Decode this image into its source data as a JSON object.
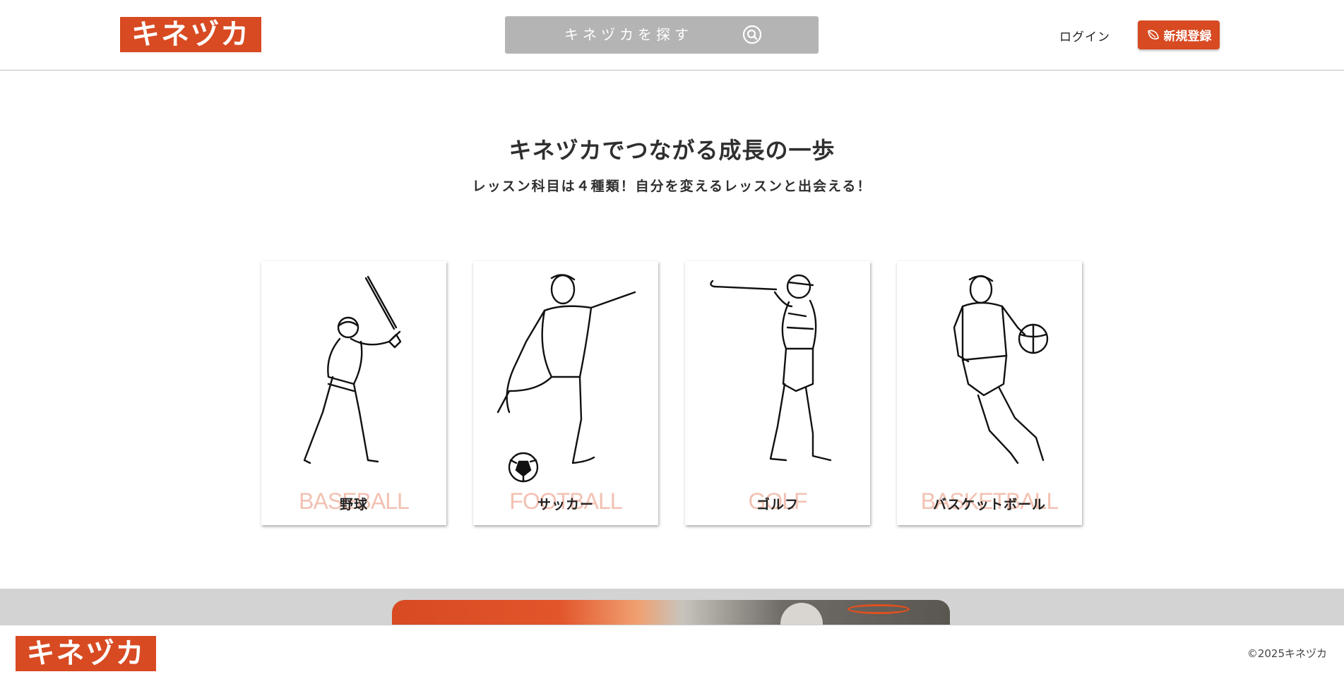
{
  "header": {
    "logo_text": "キネヅカ",
    "search_placeholder": "キネヅカを探す",
    "login_label": "ログイン",
    "signup_label": "新規登録",
    "accent_color": "#d84a22",
    "search_icon": "search-icon",
    "signup_icon": "leaf-icon"
  },
  "hero": {
    "title": "キネヅカでつながる成長の一歩",
    "subtitle": "レッスン科目は４種類！自分を変えるレッスンと出会える！"
  },
  "cards": [
    {
      "en": "BASEBALL",
      "ja": "野球",
      "icon": "baseball-player-illustration"
    },
    {
      "en": "FOOTBALL",
      "ja": "サッカー",
      "icon": "soccer-player-illustration"
    },
    {
      "en": "GOLF",
      "ja": "ゴルフ",
      "icon": "golfer-illustration"
    },
    {
      "en": "BASKETBALL",
      "ja": "バスケットボール",
      "icon": "basketball-player-illustration"
    }
  ],
  "footer": {
    "logo_text": "キネヅカ",
    "copyright": "©2025キネヅカ"
  }
}
